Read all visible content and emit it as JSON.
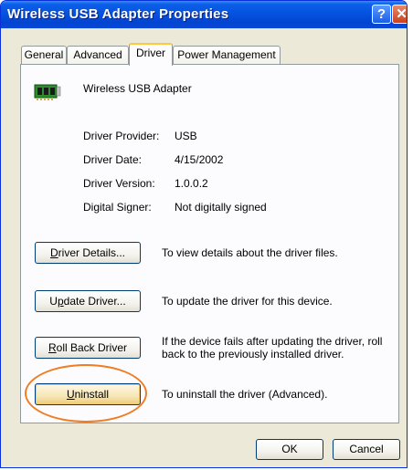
{
  "window": {
    "title": "Wireless USB Adapter Properties",
    "help_glyph": "?",
    "close_glyph": "✕"
  },
  "tabs": [
    {
      "label": "General"
    },
    {
      "label": "Advanced"
    },
    {
      "label": "Driver",
      "active": true
    },
    {
      "label": "Power Management"
    }
  ],
  "device": {
    "name": "Wireless USB Adapter",
    "icon": "network-adapter-icon"
  },
  "driver_info": {
    "provider_label": "Driver Provider:",
    "provider_value": "USB",
    "date_label": "Driver Date:",
    "date_value": "4/15/2002",
    "version_label": "Driver Version:",
    "version_value": "1.0.0.2",
    "signer_label": "Digital Signer:",
    "signer_value": "Not digitally signed"
  },
  "actions": {
    "details": {
      "label_prefix": "",
      "mnemonic": "D",
      "label_rest": "river Details...",
      "description": "To view details about the driver files."
    },
    "update": {
      "label_prefix": "U",
      "mnemonic": "p",
      "label_rest": "date Driver...",
      "description": "To update the driver for this device."
    },
    "rollback": {
      "label_prefix": "",
      "mnemonic": "R",
      "label_rest": "oll Back Driver",
      "description_line1": "If the device fails after updating the driver, roll",
      "description_line2": "back to the previously installed driver."
    },
    "uninstall": {
      "label_prefix": "",
      "mnemonic": "U",
      "label_rest": "ninstall",
      "description": "To uninstall the driver (Advanced)."
    }
  },
  "footer": {
    "ok_label": "OK",
    "cancel_label": "Cancel"
  },
  "colors": {
    "title_bar": "#0553e0",
    "highlight_ring": "#ef7d23",
    "active_tab_accent": "#ffc73c"
  }
}
